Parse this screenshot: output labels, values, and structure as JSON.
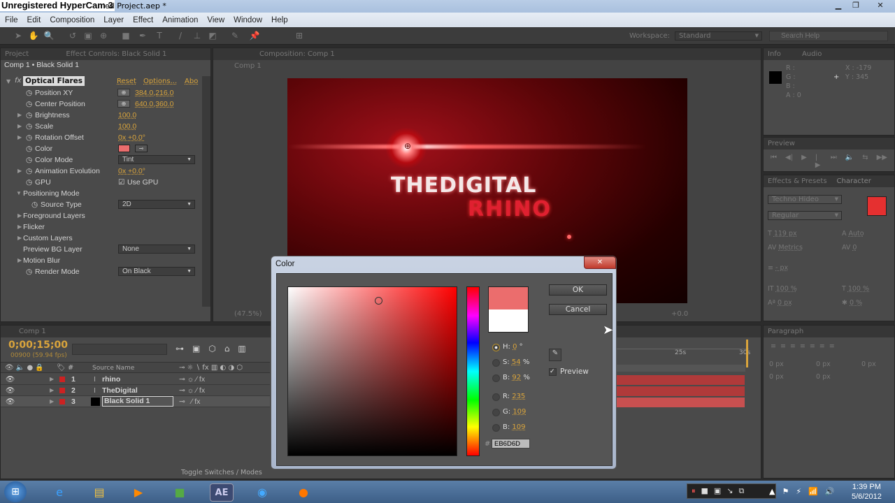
{
  "window": {
    "recorder_label": "Unregistered HyperCam 3",
    "title": "ed Project.aep *",
    "controls": [
      "minimize",
      "maximize",
      "close"
    ]
  },
  "menu": [
    "File",
    "Edit",
    "Composition",
    "Layer",
    "Effect",
    "Animation",
    "View",
    "Window",
    "Help"
  ],
  "toolbar": {
    "workspace_label": "Workspace:",
    "workspace_value": "Standard",
    "search_placeholder": "Search Help"
  },
  "effect_controls": {
    "tabs": [
      "Project",
      "Effect Controls: Black Solid 1"
    ],
    "breadcrumb": "Comp 1 • Black Solid 1",
    "effect_name": "Optical Flares",
    "reset": "Reset",
    "options": "Options...",
    "about": "Abo",
    "props": [
      {
        "label": "Position XY",
        "value": "384.0,216.0",
        "indent": 1,
        "stopwatch": true,
        "crosshair": true
      },
      {
        "label": "Center Position",
        "value": "640.0,360.0",
        "indent": 1,
        "stopwatch": true,
        "crosshair": true
      },
      {
        "label": "Brightness",
        "value": "100.0",
        "indent": 1,
        "stopwatch": true,
        "twirl": true
      },
      {
        "label": "Scale",
        "value": "100.0",
        "indent": 1,
        "stopwatch": true,
        "twirl": true
      },
      {
        "label": "Rotation Offset",
        "value": "0x +0.0°",
        "indent": 1,
        "stopwatch": true,
        "twirl": true
      },
      {
        "label": "Color",
        "swatch": "#EB6D6D",
        "indent": 1,
        "stopwatch": true
      },
      {
        "label": "Color Mode",
        "dropdown": "Tint",
        "indent": 1,
        "stopwatch": true
      },
      {
        "label": "Animation Evolution",
        "value": "0x +0.0°",
        "indent": 1,
        "stopwatch": true,
        "twirl": true
      },
      {
        "label": "GPU",
        "checkbox": "Use GPU",
        "indent": 1,
        "stopwatch": true
      },
      {
        "label": "Positioning Mode",
        "indent": 0,
        "open": true
      },
      {
        "label": "Source Type",
        "dropdown": "2D",
        "indent": 2,
        "stopwatch": true
      },
      {
        "label": "Foreground Layers",
        "indent": 0,
        "twirl": true
      },
      {
        "label": "Flicker",
        "indent": 0,
        "twirl": true
      },
      {
        "label": "Custom Layers",
        "indent": 0,
        "twirl": true
      },
      {
        "label": "Preview BG Layer",
        "dropdown": "None",
        "indent": 0
      },
      {
        "label": "Motion Blur",
        "indent": 0,
        "twirl": true
      },
      {
        "label": "Render Mode",
        "dropdown": "On Black",
        "indent": 1,
        "stopwatch": true
      }
    ]
  },
  "composition": {
    "tab": "Composition: Comp 1",
    "breadcrumb": "Comp 1",
    "zoom": "(47.5%)",
    "exposure": "+0.0",
    "title_line1": "THEDIGITAL",
    "title_line2": "RHINO"
  },
  "info": {
    "tabs": [
      "Info",
      "Audio"
    ],
    "r": "R :",
    "g": "G :",
    "b": "B :",
    "a": "A : 0",
    "x": "X : -179",
    "y": "Y : 345"
  },
  "preview": {
    "tab": "Preview"
  },
  "character": {
    "tabs": [
      "Effects & Presets",
      "Character"
    ],
    "font": "Techno Hideo",
    "style": "Regular",
    "size": "119 px",
    "leading": "Auto",
    "kerning": "Metrics",
    "tracking": "0",
    "stroke": "- px",
    "vscale": "100 %",
    "hscale": "100 %",
    "baseline": "0 px",
    "tsume": "0 %",
    "fill_color": "#E53030"
  },
  "paragraph": {
    "tab": "Paragraph",
    "indents": [
      "0 px",
      "0 px",
      "0 px",
      "0 px",
      "0 px"
    ]
  },
  "timeline": {
    "tab": "Comp 1",
    "timecode": "0;00;15;00",
    "frames": "00900 (59.94 fps)",
    "col_source": "Source Name",
    "ruler": [
      "25s",
      "30s"
    ],
    "toggle": "Toggle Switches / Modes",
    "layers": [
      {
        "num": "1",
        "name": "rhino",
        "type": "text"
      },
      {
        "num": "2",
        "name": "TheDigital",
        "type": "text"
      },
      {
        "num": "3",
        "name": "Black Solid 1",
        "type": "solid",
        "selected": true
      }
    ]
  },
  "color_dialog": {
    "title": "Color",
    "ok": "OK",
    "cancel": "Cancel",
    "h_label": "H:",
    "h": "0",
    "h_unit": "°",
    "s_label": "S:",
    "s": "54",
    "s_unit": "%",
    "b_label": "B:",
    "b": "92",
    "b_unit": "%",
    "r_label": "R:",
    "r": "235",
    "g_label": "G:",
    "g": "109",
    "bb_label": "B:",
    "bb": "109",
    "hex_label": "#",
    "hex": "EB6D6D",
    "preview": "Preview",
    "preview_checked": true,
    "new_color": "#EB6D6D",
    "old_color": "#FFFFFF"
  },
  "taskbar": {
    "time": "1:39 PM",
    "date": "5/6/2012",
    "apps": [
      "start",
      "internet-explorer",
      "explorer",
      "media-player",
      "minecraft",
      "after-effects",
      "hypercam",
      "firefox"
    ]
  }
}
